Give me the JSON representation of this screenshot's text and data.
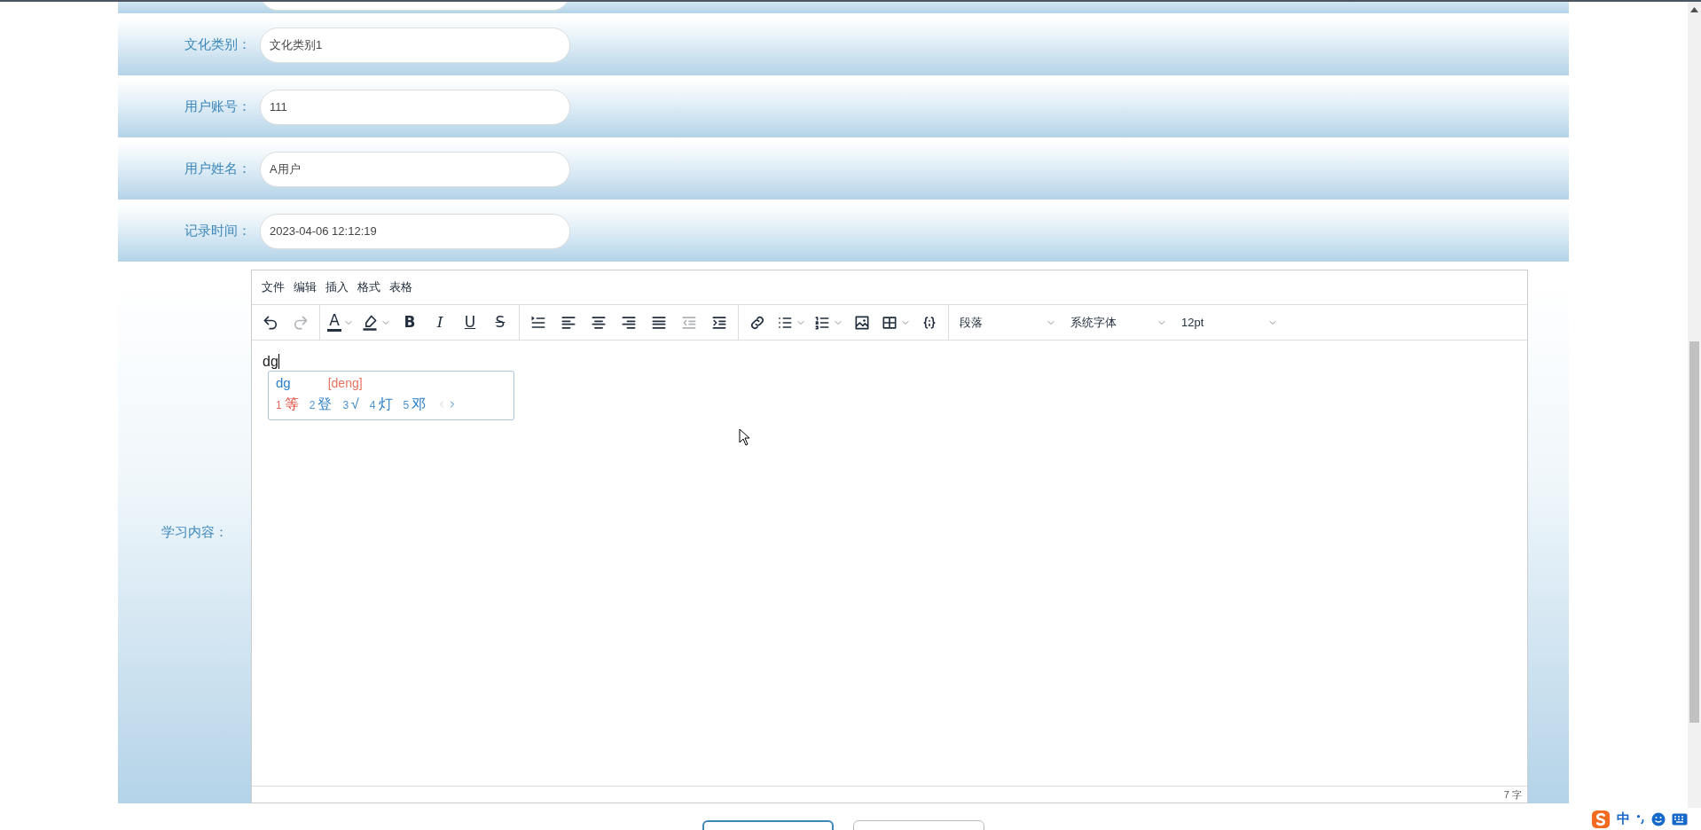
{
  "form_rows": [
    {
      "label": "文化类别：",
      "value": "文化类别1"
    },
    {
      "label": "用户账号：",
      "value": "111"
    },
    {
      "label": "用户姓名：",
      "value": "A用户"
    },
    {
      "label": "记录时间：",
      "value": "2023-04-06 12:12:19"
    }
  ],
  "editor": {
    "label": "学习内容：",
    "menubar": [
      "文件",
      "编辑",
      "插入",
      "格式",
      "表格"
    ],
    "toolbar": [
      [
        {
          "kind": "icon",
          "disabled": false
        },
        {
          "kind": "icon",
          "disabled": true
        }
      ],
      [
        {
          "kind": "split-letter",
          "text": "A",
          "disabled": false
        },
        {
          "kind": "split-icon",
          "disabled": false
        },
        {
          "kind": "letter",
          "text": "B",
          "disabled": false
        },
        {
          "kind": "letter",
          "text": "I",
          "disabled": false
        },
        {
          "kind": "letter",
          "text": "U",
          "disabled": false
        },
        {
          "kind": "letter",
          "text": "S",
          "disabled": false
        }
      ],
      [
        {
          "kind": "icon",
          "disabled": false
        },
        {
          "kind": "icon",
          "disabled": false
        },
        {
          "kind": "icon",
          "disabled": false
        },
        {
          "kind": "icon",
          "disabled": false
        },
        {
          "kind": "icon",
          "disabled": false
        },
        {
          "kind": "icon",
          "disabled": true
        },
        {
          "kind": "icon",
          "disabled": false
        }
      ],
      [
        {
          "kind": "icon",
          "disabled": false
        },
        {
          "kind": "split-icon",
          "disabled": false
        },
        {
          "kind": "split-icon",
          "disabled": false
        },
        {
          "kind": "icon",
          "disabled": false
        },
        {
          "kind": "split-icon",
          "disabled": false
        },
        {
          "kind": "icon",
          "disabled": false
        }
      ],
      [
        {
          "kind": "select",
          "text": "段落",
          "disabled": false
        },
        {
          "kind": "select",
          "text": "系统字体",
          "disabled": false
        },
        {
          "kind": "select",
          "text": "12pt",
          "disabled": false
        }
      ]
    ],
    "content": "dg",
    "word_count": "7 字"
  },
  "ime": {
    "input": "dg",
    "pinyin": "[deng]",
    "candidates": [
      {
        "index": "1",
        "text": "等",
        "selected": true
      },
      {
        "index": "2",
        "text": "登",
        "selected": false
      },
      {
        "index": "3",
        "text": "√",
        "selected": false
      },
      {
        "index": "4",
        "text": "灯",
        "selected": false
      },
      {
        "index": "5",
        "text": "邓",
        "selected": false
      }
    ]
  },
  "tray": {
    "mode": "中"
  }
}
